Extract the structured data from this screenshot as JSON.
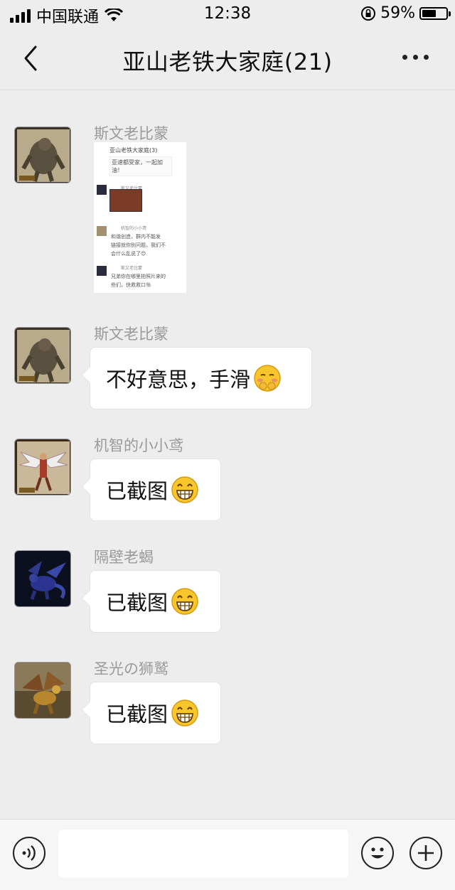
{
  "status_bar": {
    "carrier": "中国联通",
    "time": "12:38",
    "battery": "59%",
    "battery_level": 0.59
  },
  "header": {
    "title": "亚山老铁大家庭(21)"
  },
  "messages": [
    {
      "sender": "斯文老比蒙",
      "type": "image",
      "avatar": "behemoth-avatar",
      "image": {
        "title": "亚山老铁大家庭(3)",
        "lines": [
          "亚速都受家，一起加油！",
          "斯文老比蒙",
          "机智的小小鸢",
          "和谐创造，群内不能发",
          "链接就你别问题，我们不",
          "会什么乱说了😊",
          "斯文老比蒙",
          "兄弟你在哪里拍照片来的",
          "些们，快救救口🐘"
        ]
      }
    },
    {
      "sender": "斯文老比蒙",
      "type": "text",
      "text": "不好意思，手滑",
      "emoji": "embarrassed-emoji",
      "avatar": "behemoth-avatar"
    },
    {
      "sender": "机智的小小鸢",
      "type": "text",
      "text": "已截图",
      "emoji": "grin-emoji",
      "avatar": "winged-warrior-avatar"
    },
    {
      "sender": "隔壁老蝎",
      "type": "text",
      "text": "已截图",
      "emoji": "grin-emoji",
      "avatar": "blue-dragon-avatar"
    },
    {
      "sender": "圣光の狮鹫",
      "type": "text",
      "text": "已截图",
      "emoji": "grin-emoji",
      "avatar": "griffin-avatar"
    }
  ],
  "input_bar": {
    "placeholder": "",
    "icons": [
      "voice-icon",
      "emoji-icon",
      "plus-icon"
    ]
  },
  "colors": {
    "background": "#ededed",
    "bubble": "#ffffff",
    "sender": "#9a9a9a",
    "emoji_yellow": "#f7c52c"
  }
}
